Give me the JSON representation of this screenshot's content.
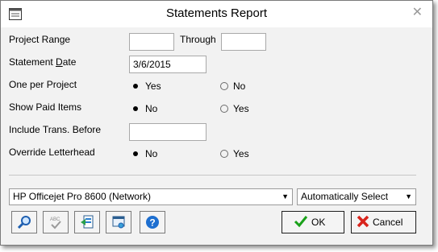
{
  "window": {
    "title": "Statements Report",
    "close_glyph": "✕"
  },
  "fields": {
    "project_range_label": "Project Range",
    "project_from_value": "",
    "through_label": "Through",
    "project_to_value": "",
    "statement_date_label_pre": "Statement ",
    "statement_date_label_underlined": "D",
    "statement_date_label_post": "ate",
    "statement_date_value": "3/6/2015",
    "one_per_project_label": "One per Project",
    "show_paid_items_label": "Show Paid Items",
    "include_trans_before_label": "Include Trans. Before",
    "include_trans_before_value": "",
    "override_letterhead_label": "Override Letterhead"
  },
  "radios": {
    "one_per_project": {
      "yes": "Yes",
      "no": "No",
      "selected": "Yes"
    },
    "show_paid_items": {
      "no": "No",
      "yes": "Yes",
      "selected": "No"
    },
    "override_letterhead": {
      "no": "No",
      "yes": "Yes",
      "selected": "No"
    }
  },
  "printer": {
    "selected": "HP Officejet Pro 8600 (Network)"
  },
  "tray": {
    "selected": "Automatically Select"
  },
  "toolbar": {
    "icons": [
      "search-icon",
      "spell-check-icon",
      "export-icon",
      "printer-setup-icon",
      "help-icon"
    ]
  },
  "buttons": {
    "ok_label": "OK",
    "cancel_label": "Cancel"
  },
  "colors": {
    "ok_check": "#1aa11a",
    "cancel_x": "#d9241c",
    "help_blue": "#1e6fd0"
  }
}
